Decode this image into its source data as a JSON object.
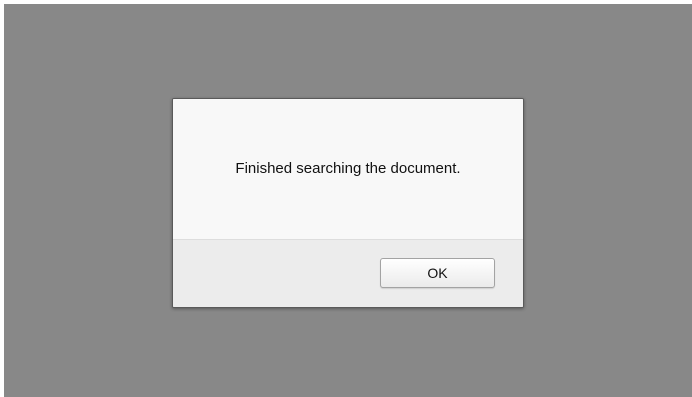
{
  "dialog": {
    "message": "Finished searching the document.",
    "ok_label": "OK"
  }
}
